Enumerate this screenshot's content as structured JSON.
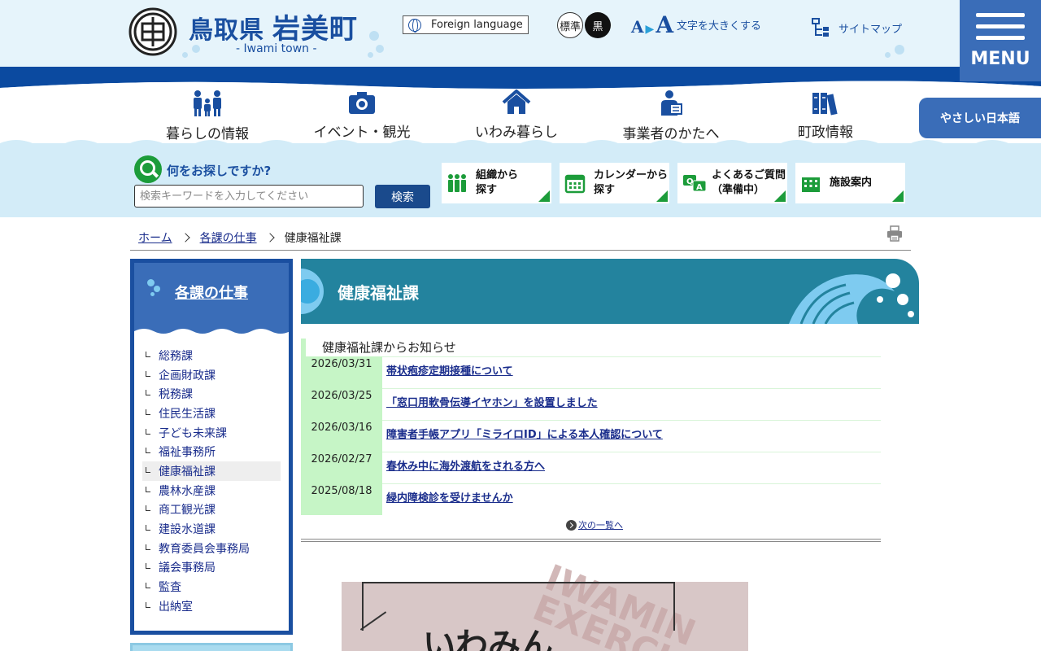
{
  "header": {
    "logo_icon": "town-emblem-icon",
    "pref": "鳥取県",
    "town": "岩美町",
    "subtitle": "- Iwami town -",
    "foreign_label": "Foreign language",
    "color_standard": "標準",
    "color_black": "黒",
    "font_aa_small": "A",
    "font_aa_big": "A",
    "font_label": "文字を大きくする",
    "sitemap_label": "サイトマップ",
    "menu_label": "MENU",
    "easy_japanese": "やさしい日本語"
  },
  "gnav": [
    {
      "label": "暮らしの情報",
      "icon": "family-icon"
    },
    {
      "label": "イベント・観光",
      "icon": "camera-icon"
    },
    {
      "label": "いわみ暮らし",
      "icon": "home-icon"
    },
    {
      "label": "事業者のかたへ",
      "icon": "businessperson-icon"
    },
    {
      "label": "町政情報",
      "icon": "books-icon"
    }
  ],
  "search": {
    "question": "何をお探しですか?",
    "placeholder": "検索キーワードを入力してください",
    "submit": "検索"
  },
  "quick_links": [
    {
      "label": "組織から\n探す",
      "icon": "people-icon"
    },
    {
      "label": "カレンダーから\n探す",
      "icon": "calendar-icon"
    },
    {
      "label": "よくあるご質問\n（準備中）",
      "icon": "qa-icon"
    },
    {
      "label": "施設案内",
      "icon": "building-icon"
    }
  ],
  "breadcrumb": {
    "home": "ホーム",
    "parent": "各課の仕事",
    "current": "健康福祉課"
  },
  "sidebar": {
    "title": "各課の仕事",
    "items": [
      "総務課",
      "企画財政課",
      "税務課",
      "住民生活課",
      "子ども未来課",
      "福祉事務所",
      "健康福祉課",
      "農林水産課",
      "商工観光課",
      "建設水道課",
      "教育委員会事務局",
      "議会事務局",
      "監査",
      "出納室"
    ],
    "active_index": 6
  },
  "main": {
    "title": "健康福祉課",
    "news_heading": "健康福祉課からお知らせ",
    "news": [
      {
        "date": "2026/03/31",
        "title": "帯状疱疹定期接種について"
      },
      {
        "date": "2026/03/25",
        "title": "「窓口用軟骨伝導イヤホン」を設置しました"
      },
      {
        "date": "2026/03/16",
        "title": "障害者手帳アプリ「ミライロID」による本人確認について"
      },
      {
        "date": "2026/02/27",
        "title": "春休み中に海外渡航をされる方へ"
      },
      {
        "date": "2025/08/18",
        "title": "緑内障検診を受けませんか"
      }
    ],
    "more_label": "次の一覧へ",
    "banner_text": "いわみん",
    "banner_rotated": "IWAMIN\nEXERCI"
  },
  "colors": {
    "brand_blue": "#1a4fa0",
    "menu_blue": "#3a6db8",
    "title_teal": "#23839e",
    "accent_green": "#1c9c3a",
    "date_green": "#c6f5c6"
  }
}
